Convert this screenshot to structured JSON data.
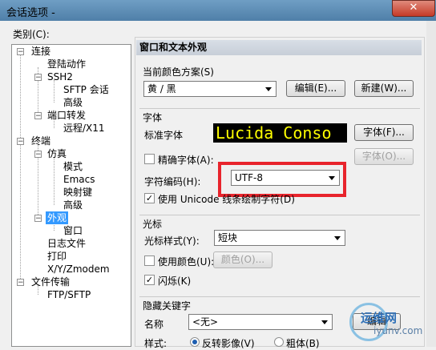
{
  "window": {
    "title": "会话选项 -",
    "close_glyph": "✕"
  },
  "category_label": "类别(C):",
  "tree": [
    {
      "label": "连接",
      "box": "−"
    },
    {
      "label": "登陆动作"
    },
    {
      "label": "SSH2",
      "box": "−"
    },
    {
      "label": "SFTP 会话"
    },
    {
      "label": "高级"
    },
    {
      "label": "端口转发",
      "box": "−"
    },
    {
      "label": "远程/X11"
    },
    {
      "label": "终端",
      "box": "−"
    },
    {
      "label": "仿真",
      "box": "−"
    },
    {
      "label": "模式"
    },
    {
      "label": "Emacs"
    },
    {
      "label": "映射键"
    },
    {
      "label": "高级"
    },
    {
      "label": "外观",
      "box": "−",
      "selected": true
    },
    {
      "label": "窗口"
    },
    {
      "label": "日志文件"
    },
    {
      "label": "打印"
    },
    {
      "label": "X/Y/Zmodem"
    },
    {
      "label": "文件传输",
      "box": "−"
    },
    {
      "label": "FTP/SFTP"
    }
  ],
  "panel": {
    "header": "窗口和文本外观",
    "scheme": {
      "label": "当前颜色方案(S)",
      "value": "黄 / 黑",
      "edit_button": "编辑(E)...",
      "new_button": "新建(W)..."
    },
    "font": {
      "group": "字体",
      "standard_label": "标准字体",
      "preview": "Lucida Conso",
      "font_button": "字体(F)...",
      "precise_label": "精确字体(A):",
      "precise_checked": false,
      "precise_button": "字体(O)...",
      "encoding_label": "字符编码(H):",
      "encoding_value": "UTF-8",
      "unicode_label": "使用 Unicode 线条绘制字符(D)",
      "unicode_checked": true
    },
    "cursor": {
      "group": "光标",
      "style_label": "光标样式(Y):",
      "style_value": "短块",
      "color_label": "使用颜色(U):",
      "color_checked": false,
      "color_button": "颜色(O)...",
      "blink_label": "闪烁(K)",
      "blink_checked": true
    },
    "keyword": {
      "group": "隐藏关键字",
      "name_label": "名称",
      "name_value": "<无>",
      "edit_button": "编辑",
      "style_label": "样式:",
      "reverse_label": "反转影像(V)",
      "reverse_selected": true,
      "bold_label": "粗体(B)",
      "bold_selected": false
    }
  },
  "watermark": {
    "line1": "运维网",
    "line2": "iyunv.com"
  },
  "colors": {
    "highlight": "#e8242c",
    "selection": "#3399ff",
    "preview_fg": "#ffff00",
    "preview_bg": "#000000"
  }
}
